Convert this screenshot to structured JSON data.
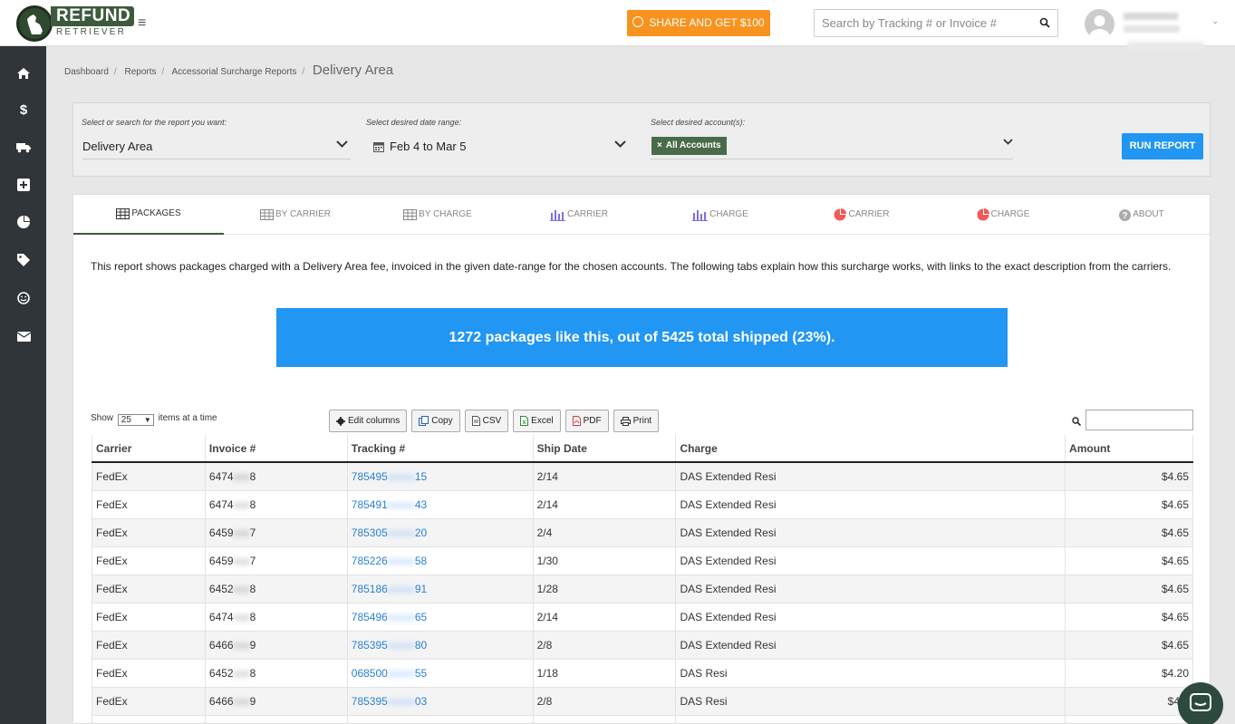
{
  "brand": {
    "name": "REFUND",
    "sub": "RETRIEVER"
  },
  "header": {
    "share_label": "SHARE AND GET $100",
    "search_placeholder": "Search by Tracking # or Invoice #"
  },
  "sidebar": {
    "icons": [
      "home-icon",
      "dollar-icon",
      "truck-icon",
      "plus-square-icon",
      "pie-chart-icon",
      "tag-icon",
      "smile-icon",
      "envelope-icon"
    ]
  },
  "breadcrumb": {
    "items": [
      "Dashboard",
      "Reports",
      "Accessorial Surcharge Reports"
    ],
    "current": "Delivery Area"
  },
  "filters": {
    "report_label": "Select or search for the report you want:",
    "report_value": "Delivery Area",
    "date_label": "Select desired date range:",
    "date_value": "Feb 4 to Mar 5",
    "account_label": "Select desired account(s):",
    "account_chip": "All Accounts",
    "run_label": "RUN REPORT"
  },
  "tabs": [
    {
      "label": "PACKAGES",
      "icon": "table-icon"
    },
    {
      "label": "BY CARRIER",
      "icon": "table-icon"
    },
    {
      "label": "BY CHARGE",
      "icon": "table-icon"
    },
    {
      "label": "CARRIER",
      "icon": "bar-chart-icon"
    },
    {
      "label": "CHARGE",
      "icon": "bar-chart-icon"
    },
    {
      "label": "CARRIER",
      "icon": "pie-chart-icon"
    },
    {
      "label": "CHARGE",
      "icon": "pie-chart-icon"
    },
    {
      "label": "ABOUT",
      "icon": "question-icon"
    }
  ],
  "description": "This report shows packages charged with a Delivery Area fee, invoiced in the given date-range for the chosen accounts. The following tabs explain how this surcharge works, with links to the exact description from the carriers.",
  "summary": {
    "count": "1272 packages",
    "rest": " like this, out of 5425 total shipped (23%)."
  },
  "table_controls": {
    "show_prefix": "Show",
    "page_size": "25",
    "show_suffix": "items at a time",
    "buttons": [
      "Edit columns",
      "Copy",
      "CSV",
      "Excel",
      "PDF",
      "Print"
    ]
  },
  "table": {
    "columns": [
      "Carrier",
      "Invoice #",
      "Tracking #",
      "Ship Date",
      "Charge",
      "Amount"
    ],
    "rows": [
      {
        "carrier": "FedEx",
        "inv_a": "6474",
        "inv_b": "8",
        "trk_a": "785495",
        "trk_b": "15",
        "date": "2/14",
        "charge": "DAS Extended Resi",
        "amount": "$4.65"
      },
      {
        "carrier": "FedEx",
        "inv_a": "6474",
        "inv_b": "8",
        "trk_a": "785491",
        "trk_b": "43",
        "date": "2/14",
        "charge": "DAS Extended Resi",
        "amount": "$4.65"
      },
      {
        "carrier": "FedEx",
        "inv_a": "6459",
        "inv_b": "7",
        "trk_a": "785305",
        "trk_b": "20",
        "date": "2/4",
        "charge": "DAS Extended Resi",
        "amount": "$4.65"
      },
      {
        "carrier": "FedEx",
        "inv_a": "6459",
        "inv_b": "7",
        "trk_a": "785226",
        "trk_b": "58",
        "date": "1/30",
        "charge": "DAS Extended Resi",
        "amount": "$4.65"
      },
      {
        "carrier": "FedEx",
        "inv_a": "6452",
        "inv_b": "8",
        "trk_a": "785186",
        "trk_b": "91",
        "date": "1/28",
        "charge": "DAS Extended Resi",
        "amount": "$4.65"
      },
      {
        "carrier": "FedEx",
        "inv_a": "6474",
        "inv_b": "8",
        "trk_a": "785496",
        "trk_b": "65",
        "date": "2/14",
        "charge": "DAS Extended Resi",
        "amount": "$4.65"
      },
      {
        "carrier": "FedEx",
        "inv_a": "6466",
        "inv_b": "9",
        "trk_a": "785395",
        "trk_b": "80",
        "date": "2/8",
        "charge": "DAS Extended Resi",
        "amount": "$4.65"
      },
      {
        "carrier": "FedEx",
        "inv_a": "6452",
        "inv_b": "8",
        "trk_a": "068500",
        "trk_b": "55",
        "date": "1/18",
        "charge": "DAS Resi",
        "amount": "$4.20"
      },
      {
        "carrier": "FedEx",
        "inv_a": "6466",
        "inv_b": "9",
        "trk_a": "785395",
        "trk_b": "03",
        "date": "2/8",
        "charge": "DAS Resi",
        "amount": "$4.2"
      }
    ]
  }
}
